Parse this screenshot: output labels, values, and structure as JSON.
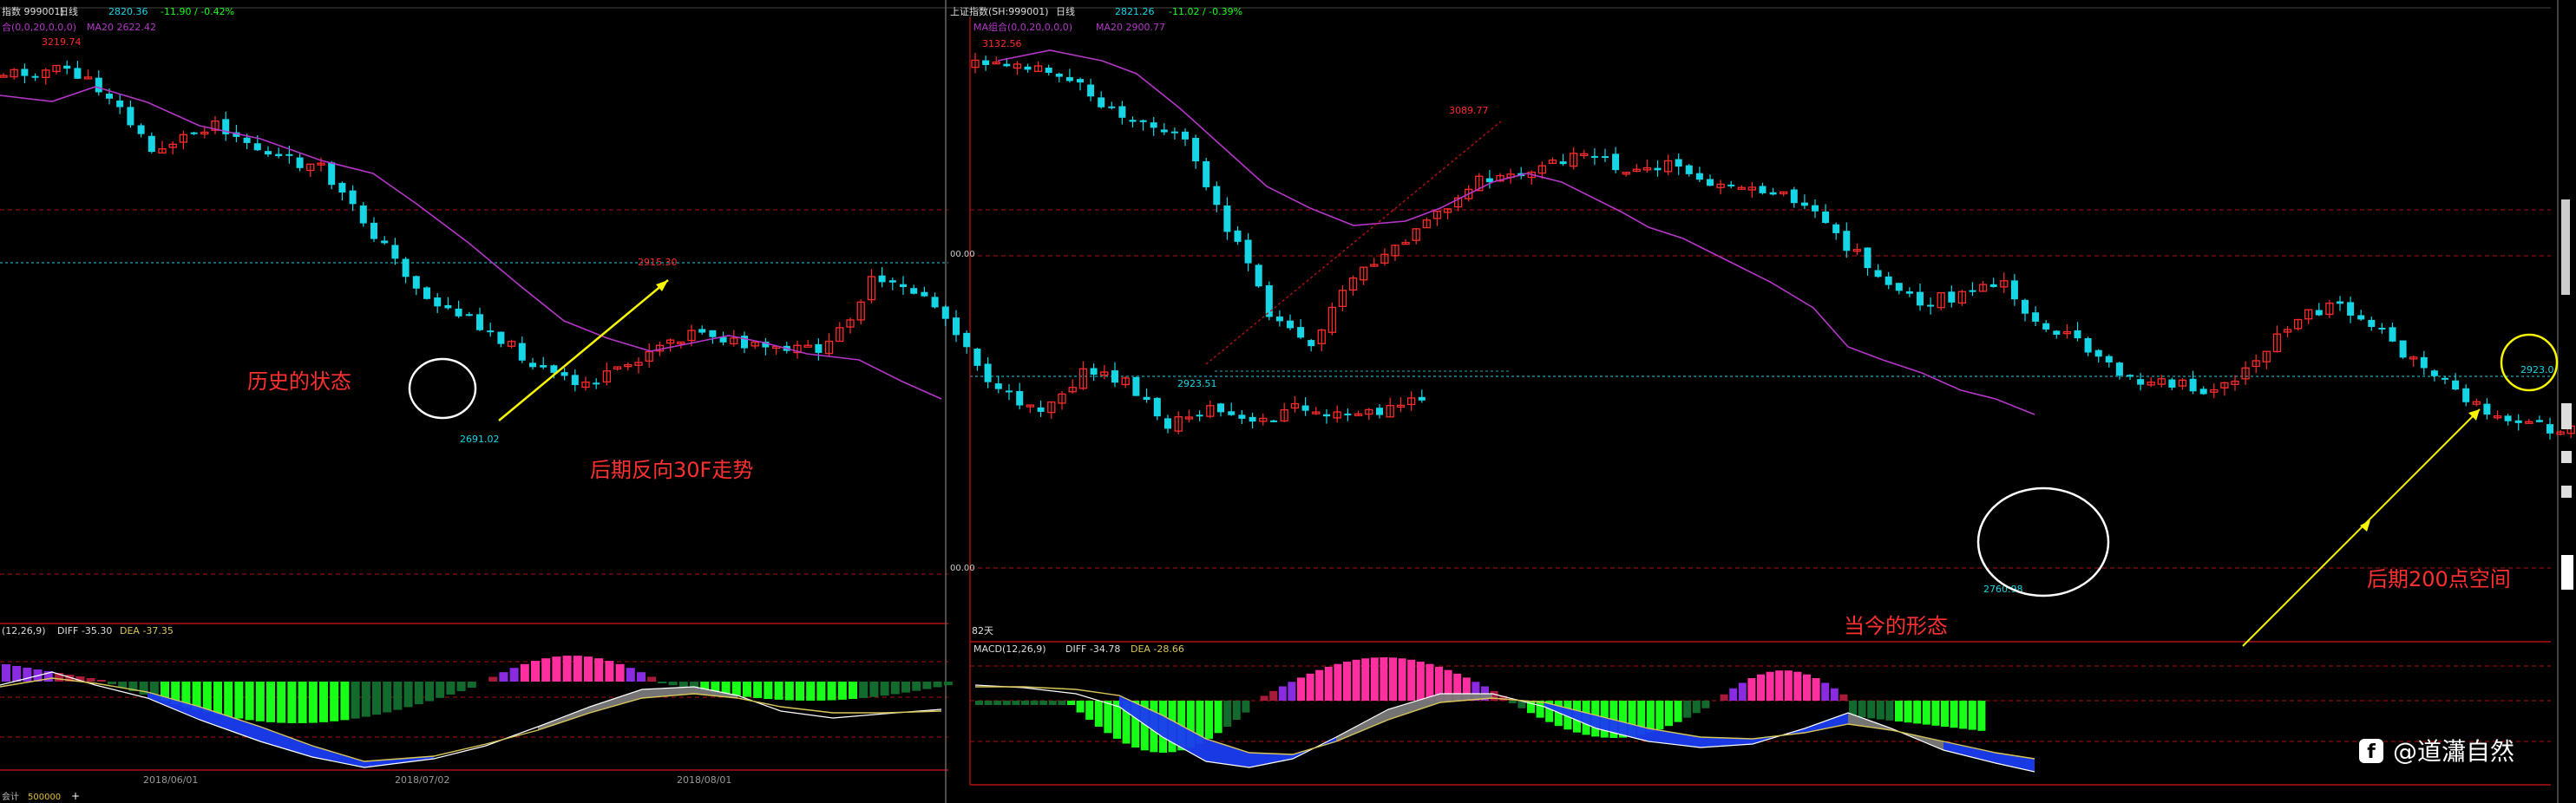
{
  "colors": {
    "bg": "#000000",
    "up": "#ff2b2b",
    "down": "#16d6e6",
    "ma20": "#b536c8",
    "grid_red": "#b01010",
    "dotted_cyan": "#17a8b8",
    "dea_yellow": "#d8c65a",
    "macd_pos_low": "#a81a3a",
    "macd_pos_high": "#ff2fa0",
    "macd_purple": "#8a2be2",
    "macd_neg_strong": "#18ff18",
    "macd_neg_dark": "#126a2c",
    "macd_blue": "#1a3cf0",
    "macd_gray": "#7a7a7a",
    "annotation_red": "#ff3030",
    "annotation_yellow": "#f6f600",
    "white": "#ffffff"
  },
  "left_panel": {
    "header": {
      "name": "指数 999001)",
      "period": "日线",
      "price": "2820.36",
      "change": "-11.90 / -0.42%",
      "ma_label": "合(0,0,20,0,0,0)",
      "ma20_label": "MA20 2622.42"
    },
    "macd_header": {
      "label": "(12,26,9)",
      "diff": "DIFF -35.30",
      "dea": "DEA -37.35"
    },
    "x_labels": [
      "2018/06/01",
      "2018/07/02",
      "2018/08/01"
    ],
    "status_left": "会计",
    "status_value": "500000",
    "status_plus": "+"
  },
  "right_panel": {
    "header": {
      "name": "上证指数(SH:999001)",
      "period": "日线",
      "price": "2821.26",
      "change": "-11.02 / -0.39%",
      "ma_label": "MA组合(0,0,20,0,0,0)",
      "ma20_label": "MA20 2900.77"
    },
    "macd_header": {
      "label": "MACD(12,26,9)",
      "diff": "DIFF -34.78",
      "dea": "DEA -28.66"
    },
    "days_label": "82天",
    "axis_labels": [
      "00.00",
      "00.00"
    ]
  },
  "annotations": {
    "left_state": "历史的状态",
    "left_future": "后期反向30F走势",
    "right_state": "当今的形态",
    "right_future": "后期200点空间",
    "watermark": "@道瀟自然",
    "price_labels": {
      "l_high": "3219.74",
      "l_low": "2691.02",
      "l_mid": "2915.30",
      "r_high": "3132.56",
      "r_peak": "3089.77",
      "r_low1": "2923.51",
      "r_low2": "2760.98",
      "target": "2923.0"
    }
  },
  "chart_data": [
    {
      "type": "candlestick",
      "title": "",
      "x_labels": [
        "2018/06/01",
        "2018/07/02",
        "2018/08/01"
      ],
      "labels": [
        "3219.74",
        "2915.30",
        "2691.02"
      ],
      "series": [
        {
          "name": "MA20",
          "values": [
            2622.42
          ]
        }
      ]
    },
    {
      "type": "candlestick",
      "title": "上证指数(SH:999001)",
      "labels": [
        "3132.56",
        "3089.77",
        "2923.51",
        "2760.98"
      ],
      "series": [
        {
          "name": "MA20",
          "values": [
            2900.77
          ]
        }
      ]
    }
  ]
}
